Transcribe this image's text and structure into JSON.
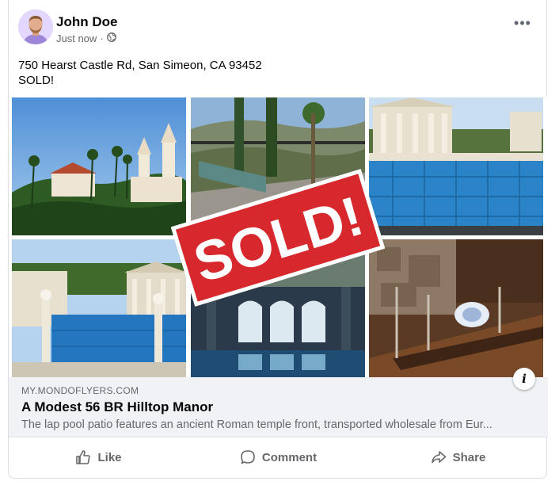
{
  "post": {
    "author": "John Doe",
    "time": "Just now",
    "privacy_icon": "globe-icon",
    "text_line1": "750 Hearst Castle Rd, San Simeon, CA 93452",
    "text_line2": "SOLD!"
  },
  "photos": {
    "overlay_text": "SOLD!",
    "overlay_color": "#d7282d",
    "items": [
      "castle-exterior-photo",
      "terrace-pool-photo",
      "neptune-pool-photo",
      "pool-colonnade-photo",
      "roman-pool-photo",
      "dining-hall-photo"
    ]
  },
  "link": {
    "domain": "MY.MONDOFLYERS.COM",
    "title": "A Modest 56 BR Hilltop Manor",
    "description": "The lap pool patio features an ancient Roman temple front, transported wholesale from Eur..."
  },
  "actions": {
    "like": "Like",
    "comment": "Comment",
    "share": "Share"
  },
  "colors": {
    "text_primary": "#050505",
    "text_secondary": "#65676b",
    "preview_bg": "#f0f2f5"
  }
}
